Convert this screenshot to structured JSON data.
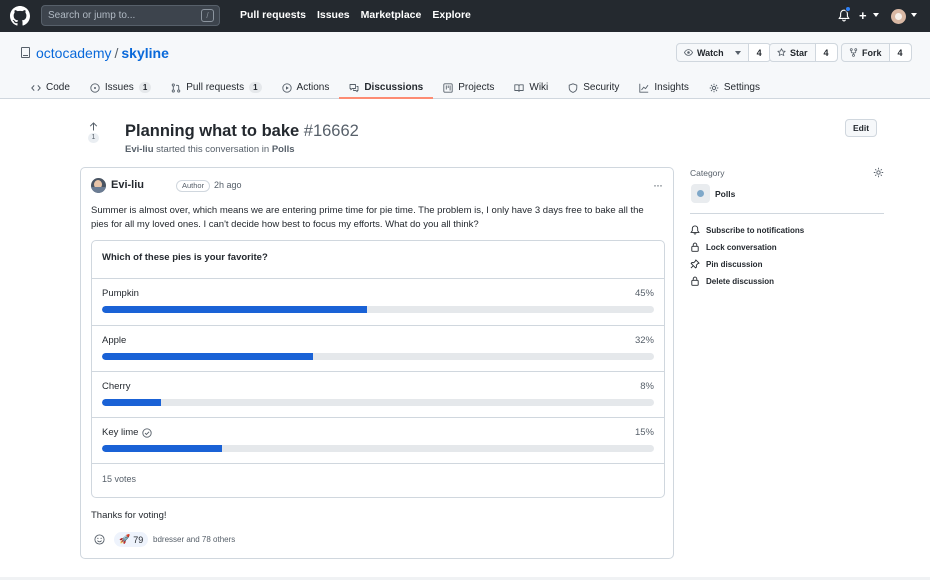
{
  "header": {
    "search_placeholder": "Search or jump to...",
    "search_key": "/",
    "nav": [
      "Pull requests",
      "Issues",
      "Marketplace",
      "Explore"
    ],
    "plus_label": "+"
  },
  "repo": {
    "owner": "octocademy",
    "separator": "/",
    "name": "skyline",
    "watch": {
      "label": "Watch",
      "count": "4"
    },
    "star": {
      "label": "Star",
      "count": "4"
    },
    "fork": {
      "label": "Fork",
      "count": "4"
    },
    "tabs": [
      {
        "label": "Code",
        "icon": "code-icon"
      },
      {
        "label": "Issues",
        "count": "1",
        "icon": "issue-icon"
      },
      {
        "label": "Pull requests",
        "count": "1",
        "icon": "pull-request-icon"
      },
      {
        "label": "Actions",
        "icon": "play-icon"
      },
      {
        "label": "Discussions",
        "icon": "discussion-icon",
        "active": true
      },
      {
        "label": "Projects",
        "icon": "project-icon"
      },
      {
        "label": "Wiki",
        "icon": "book-icon"
      },
      {
        "label": "Security",
        "icon": "shield-icon"
      },
      {
        "label": "Insights",
        "icon": "graph-icon"
      },
      {
        "label": "Settings",
        "icon": "gear-icon"
      }
    ]
  },
  "discussion": {
    "upvotes": "1",
    "title": "Planning what to bake",
    "number": "#16662",
    "author": "Evi-liu",
    "started_text": "started this conversation in",
    "category": "Polls",
    "edit_label": "Edit"
  },
  "post": {
    "author": "Evi-liu",
    "badge": "Author",
    "time": "2h ago",
    "menu": "···",
    "body": "Summer is almost over, which means we are entering prime time for pie time. The problem is, I only have 3 days free to bake all the pies for all my loved ones. I can't decide how best to focus my efforts. What do you all think?",
    "poll": {
      "question": "Which of these pies is your favorite?",
      "options": [
        {
          "label": "Pumpkin",
          "pct_text": "45%",
          "fill": 0.48,
          "voted": false
        },
        {
          "label": "Apple",
          "pct_text": "32%",
          "fill": 0.382,
          "voted": false
        },
        {
          "label": "Cherry",
          "pct_text": "8%",
          "fill": 0.107,
          "voted": false
        },
        {
          "label": "Key lime",
          "pct_text": "15%",
          "fill": 0.218,
          "voted": true
        }
      ],
      "votes": "15 votes",
      "fill_color": "#1a62d6"
    },
    "closing": "Thanks for voting!",
    "reaction": {
      "emoji": "🚀",
      "count": "79"
    },
    "reaction_others": "bdresser and 78 others"
  },
  "sidebar": {
    "category_label": "Category",
    "category_name": "Polls",
    "actions": [
      {
        "label": "Subscribe to notifications",
        "icon": "bell-icon"
      },
      {
        "label": "Lock conversation",
        "icon": "lock-icon"
      },
      {
        "label": "Pin discussion",
        "icon": "pin-icon"
      },
      {
        "label": "Delete discussion",
        "icon": "trash-icon"
      }
    ]
  }
}
